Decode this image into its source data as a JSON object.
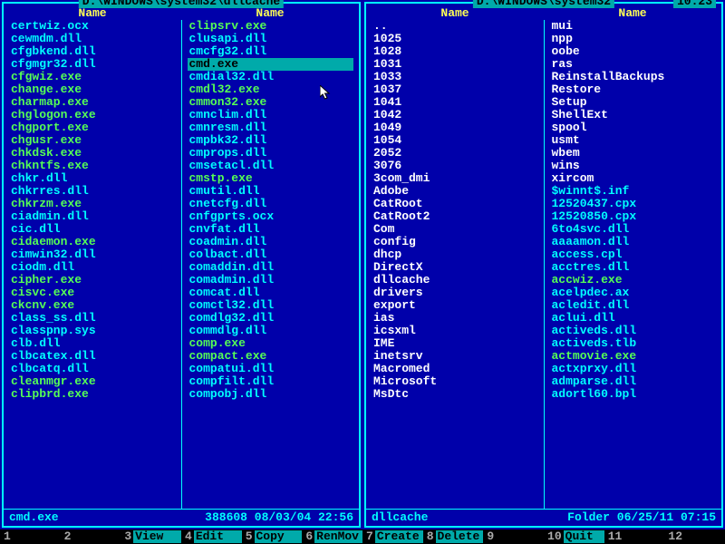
{
  "clock": "10:23",
  "left": {
    "path": " D:\\WINDOWS\\system32\\dllcache ",
    "header": "Name",
    "selected": "cmd.exe",
    "status": {
      "name": "cmd.exe",
      "info": "388608 08/03/04 22:56"
    },
    "cols": [
      [
        {
          "n": "certwiz.ocx",
          "t": "normal"
        },
        {
          "n": "cewmdm.dll",
          "t": "normal"
        },
        {
          "n": "cfgbkend.dll",
          "t": "normal"
        },
        {
          "n": "cfgmgr32.dll",
          "t": "normal"
        },
        {
          "n": "cfgwiz.exe",
          "t": "exe"
        },
        {
          "n": "change.exe",
          "t": "exe"
        },
        {
          "n": "charmap.exe",
          "t": "exe"
        },
        {
          "n": "chglogon.exe",
          "t": "exe"
        },
        {
          "n": "chgport.exe",
          "t": "exe"
        },
        {
          "n": "chgusr.exe",
          "t": "exe"
        },
        {
          "n": "chkdsk.exe",
          "t": "exe"
        },
        {
          "n": "chkntfs.exe",
          "t": "exe"
        },
        {
          "n": "chkr.dll",
          "t": "normal"
        },
        {
          "n": "chkrres.dll",
          "t": "normal"
        },
        {
          "n": "chkrzm.exe",
          "t": "exe"
        },
        {
          "n": "ciadmin.dll",
          "t": "normal"
        },
        {
          "n": "cic.dll",
          "t": "normal"
        },
        {
          "n": "cidaemon.exe",
          "t": "exe"
        },
        {
          "n": "cimwin32.dll",
          "t": "normal"
        },
        {
          "n": "ciodm.dll",
          "t": "normal"
        },
        {
          "n": "cipher.exe",
          "t": "exe"
        },
        {
          "n": "cisvc.exe",
          "t": "exe"
        },
        {
          "n": "ckcnv.exe",
          "t": "exe"
        },
        {
          "n": "class_ss.dll",
          "t": "normal"
        },
        {
          "n": "classpnp.sys",
          "t": "normal"
        },
        {
          "n": "clb.dll",
          "t": "normal"
        },
        {
          "n": "clbcatex.dll",
          "t": "normal"
        },
        {
          "n": "clbcatq.dll",
          "t": "normal"
        },
        {
          "n": "cleanmgr.exe",
          "t": "exe"
        },
        {
          "n": "clipbrd.exe",
          "t": "exe"
        }
      ],
      [
        {
          "n": "clipsrv.exe",
          "t": "exe"
        },
        {
          "n": "clusapi.dll",
          "t": "normal"
        },
        {
          "n": "cmcfg32.dll",
          "t": "normal"
        },
        {
          "n": "cmd.exe",
          "t": "exe",
          "sel": true
        },
        {
          "n": "cmdial32.dll",
          "t": "normal"
        },
        {
          "n": "cmdl32.exe",
          "t": "exe"
        },
        {
          "n": "cmmon32.exe",
          "t": "exe"
        },
        {
          "n": "cmnclim.dll",
          "t": "normal"
        },
        {
          "n": "cmnresm.dll",
          "t": "normal"
        },
        {
          "n": "cmpbk32.dll",
          "t": "normal"
        },
        {
          "n": "cmprops.dll",
          "t": "normal"
        },
        {
          "n": "cmsetacl.dll",
          "t": "normal"
        },
        {
          "n": "cmstp.exe",
          "t": "exe"
        },
        {
          "n": "cmutil.dll",
          "t": "normal"
        },
        {
          "n": "cnetcfg.dll",
          "t": "normal"
        },
        {
          "n": "cnfgprts.ocx",
          "t": "normal"
        },
        {
          "n": "cnvfat.dll",
          "t": "normal"
        },
        {
          "n": "coadmin.dll",
          "t": "normal"
        },
        {
          "n": "colbact.dll",
          "t": "normal"
        },
        {
          "n": "comaddin.dll",
          "t": "normal"
        },
        {
          "n": "comadmin.dll",
          "t": "normal"
        },
        {
          "n": "comcat.dll",
          "t": "normal"
        },
        {
          "n": "comctl32.dll",
          "t": "normal"
        },
        {
          "n": "comdlg32.dll",
          "t": "normal"
        },
        {
          "n": "commdlg.dll",
          "t": "normal"
        },
        {
          "n": "comp.exe",
          "t": "exe"
        },
        {
          "n": "compact.exe",
          "t": "exe"
        },
        {
          "n": "compatui.dll",
          "t": "normal"
        },
        {
          "n": "compfilt.dll",
          "t": "normal"
        },
        {
          "n": "compobj.dll",
          "t": "normal"
        }
      ]
    ]
  },
  "right": {
    "path": " D:\\WINDOWS\\system32 ",
    "header": "Name",
    "status": {
      "name": "dllcache",
      "info": "Folder 06/25/11 07:15"
    },
    "cols": [
      [
        {
          "n": "..",
          "t": "dir"
        },
        {
          "n": "1025",
          "t": "dir"
        },
        {
          "n": "1028",
          "t": "dir"
        },
        {
          "n": "1031",
          "t": "dir"
        },
        {
          "n": "1033",
          "t": "dir"
        },
        {
          "n": "1037",
          "t": "dir"
        },
        {
          "n": "1041",
          "t": "dir"
        },
        {
          "n": "1042",
          "t": "dir"
        },
        {
          "n": "1049",
          "t": "dir"
        },
        {
          "n": "1054",
          "t": "dir"
        },
        {
          "n": "2052",
          "t": "dir"
        },
        {
          "n": "3076",
          "t": "dir"
        },
        {
          "n": "3com_dmi",
          "t": "dir"
        },
        {
          "n": "Adobe",
          "t": "dir"
        },
        {
          "n": "CatRoot",
          "t": "dir"
        },
        {
          "n": "CatRoot2",
          "t": "dir"
        },
        {
          "n": "Com",
          "t": "dir"
        },
        {
          "n": "config",
          "t": "dir"
        },
        {
          "n": "dhcp",
          "t": "dir"
        },
        {
          "n": "DirectX",
          "t": "dir"
        },
        {
          "n": "dllcache",
          "t": "dir"
        },
        {
          "n": "drivers",
          "t": "dir"
        },
        {
          "n": "export",
          "t": "dir"
        },
        {
          "n": "ias",
          "t": "dir"
        },
        {
          "n": "icsxml",
          "t": "dir"
        },
        {
          "n": "IME",
          "t": "dir"
        },
        {
          "n": "inetsrv",
          "t": "dir"
        },
        {
          "n": "Macromed",
          "t": "dir"
        },
        {
          "n": "Microsoft",
          "t": "dir"
        },
        {
          "n": "MsDtc",
          "t": "dir"
        }
      ],
      [
        {
          "n": "mui",
          "t": "dir"
        },
        {
          "n": "npp",
          "t": "dir"
        },
        {
          "n": "oobe",
          "t": "dir"
        },
        {
          "n": "ras",
          "t": "dir"
        },
        {
          "n": "ReinstallBackups",
          "t": "dir"
        },
        {
          "n": "Restore",
          "t": "dir"
        },
        {
          "n": "Setup",
          "t": "dir"
        },
        {
          "n": "ShellExt",
          "t": "dir"
        },
        {
          "n": "spool",
          "t": "dir"
        },
        {
          "n": "usmt",
          "t": "dir"
        },
        {
          "n": "wbem",
          "t": "dir"
        },
        {
          "n": "wins",
          "t": "dir"
        },
        {
          "n": "xircom",
          "t": "dir"
        },
        {
          "n": "$winnt$.inf",
          "t": "normal"
        },
        {
          "n": "12520437.cpx",
          "t": "normal"
        },
        {
          "n": "12520850.cpx",
          "t": "normal"
        },
        {
          "n": "6to4svc.dll",
          "t": "normal"
        },
        {
          "n": "aaaamon.dll",
          "t": "normal"
        },
        {
          "n": "access.cpl",
          "t": "normal"
        },
        {
          "n": "acctres.dll",
          "t": "normal"
        },
        {
          "n": "accwiz.exe",
          "t": "exe"
        },
        {
          "n": "acelpdec.ax",
          "t": "normal"
        },
        {
          "n": "acledit.dll",
          "t": "normal"
        },
        {
          "n": "aclui.dll",
          "t": "normal"
        },
        {
          "n": "activeds.dll",
          "t": "normal"
        },
        {
          "n": "activeds.tlb",
          "t": "normal"
        },
        {
          "n": "actmovie.exe",
          "t": "exe"
        },
        {
          "n": "actxprxy.dll",
          "t": "normal"
        },
        {
          "n": "admparse.dll",
          "t": "normal"
        },
        {
          "n": "adortl60.bpl",
          "t": "normal"
        }
      ]
    ]
  },
  "fkeys": [
    {
      "num": "1",
      "label": ""
    },
    {
      "num": "2",
      "label": ""
    },
    {
      "num": "3",
      "label": "View"
    },
    {
      "num": "4",
      "label": "Edit"
    },
    {
      "num": "5",
      "label": "Copy"
    },
    {
      "num": "6",
      "label": "RenMov"
    },
    {
      "num": "7",
      "label": "Create"
    },
    {
      "num": "8",
      "label": "Delete"
    },
    {
      "num": "9",
      "label": ""
    },
    {
      "num": "10",
      "label": "Quit"
    },
    {
      "num": "11",
      "label": ""
    },
    {
      "num": "12",
      "label": ""
    }
  ]
}
